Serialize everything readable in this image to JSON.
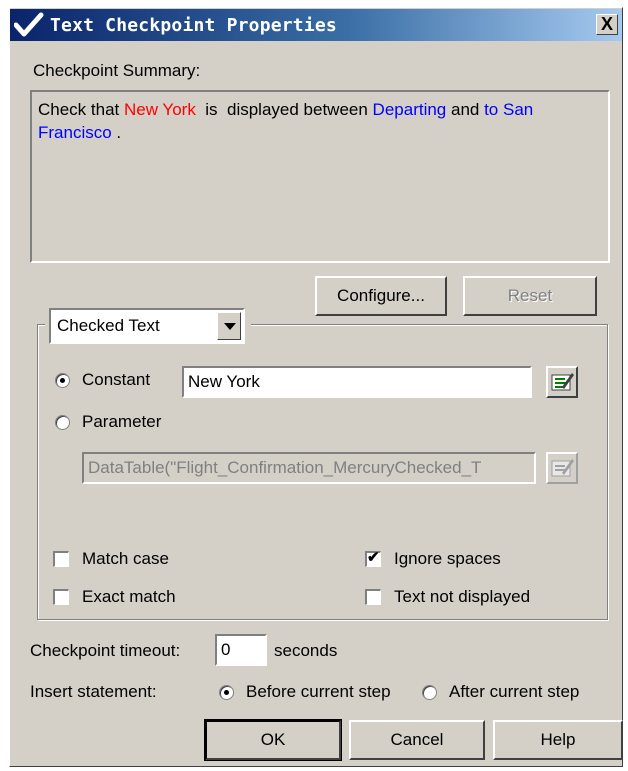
{
  "window": {
    "title": "Text Checkpoint Properties",
    "close_label": "X"
  },
  "summary": {
    "label": "Checkpoint Summary:",
    "text_prefix": "Check that ",
    "checked_value": "New York",
    "text_middle": "  is  displayed between ",
    "before_text": "Departing",
    "text_and": " and ",
    "after_text": "to San Francisco",
    "text_end": " ."
  },
  "buttons": {
    "configure": "Configure...",
    "reset": "Reset",
    "ok": "OK",
    "cancel": "Cancel",
    "help": "Help"
  },
  "checked_combo": {
    "selected": "Checked Text"
  },
  "value_source": {
    "constant_label": "Constant",
    "constant_value": "New York",
    "parameter_label": "Parameter",
    "parameter_value": "DataTable(\"Flight_Confirmation_MercuryChecked_T",
    "selected": "constant"
  },
  "options": {
    "match_case": {
      "label": "Match case",
      "checked": false
    },
    "exact_match": {
      "label": "Exact match",
      "checked": false
    },
    "ignore_spaces": {
      "label": "Ignore spaces",
      "checked": true
    },
    "text_not_displayed": {
      "label": "Text not displayed",
      "checked": false
    }
  },
  "timeout": {
    "label": "Checkpoint timeout:",
    "value": "0",
    "unit": "seconds"
  },
  "insert": {
    "label": "Insert statement:",
    "before_label": "Before current step",
    "after_label": "After current step",
    "selected": "before"
  },
  "colors": {
    "highlight_value": "#ff0000",
    "boundary_text": "#0000ff",
    "title_bar": "#0a246a"
  }
}
